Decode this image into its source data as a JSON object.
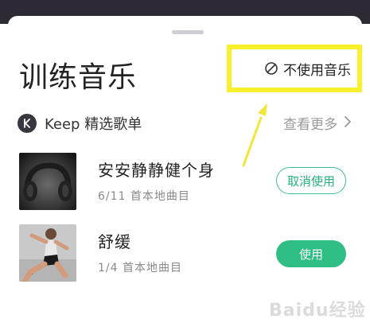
{
  "sheet": {
    "title": "训练音乐",
    "no_music_label": "不使用音乐"
  },
  "playlist": {
    "label": "Keep 精选歌单",
    "more_label": "查看更多"
  },
  "items": [
    {
      "name": "安安静静健个身",
      "meta": "6/11 首本地曲目",
      "action": "取消使用"
    },
    {
      "name": "舒缓",
      "meta": "1/4 首本地曲目",
      "action": "使用"
    }
  ],
  "watermark": "Baidu经验",
  "colors": {
    "accent": "#2fbe84",
    "highlight": "#f7f02a",
    "top_bar": "#2d2a33"
  },
  "icons": {
    "no_music": "prohibited-circle-icon",
    "keep_logo": "keep-logo-icon",
    "more": "chevron-right-icon"
  }
}
